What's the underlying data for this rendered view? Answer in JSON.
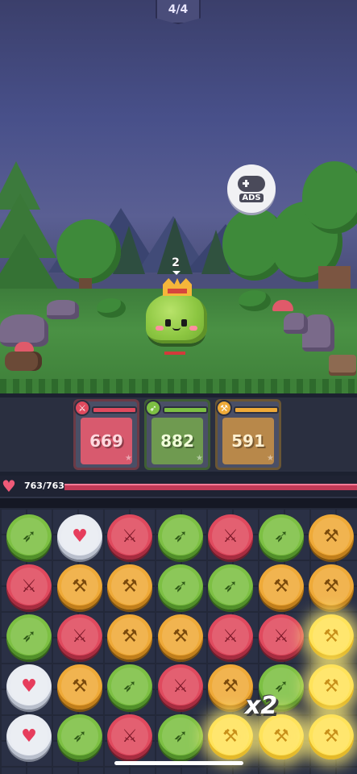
{
  "hud": {
    "wave": "4/4"
  },
  "ads_button": {
    "label": "ADS",
    "icon": "gamepad-icon"
  },
  "monster": {
    "level": "2",
    "name_icon": "crowned-slime-icon"
  },
  "attack_cards": [
    {
      "type": "sword",
      "value": "669",
      "color": "#e04a5e",
      "icon": "sword-icon"
    },
    {
      "type": "spear",
      "value": "882",
      "color": "#7dc043",
      "icon": "spear-icon"
    },
    {
      "type": "axe",
      "value": "591",
      "color": "#efaa38",
      "icon": "axe-icon"
    }
  ],
  "player": {
    "hp_text": "763/763",
    "hp_fraction": 1.0
  },
  "board": {
    "rows": [
      [
        "spear",
        "heart",
        "sword",
        "spear",
        "sword",
        "spear",
        "axe"
      ],
      [
        "sword",
        "axe",
        "axe",
        "spear",
        "spear",
        "axe",
        "axe"
      ],
      [
        "spear",
        "sword",
        "axe",
        "axe",
        "sword",
        "sword",
        "axe-glow"
      ],
      [
        "heart",
        "axe",
        "spear",
        "sword",
        "axe",
        "spear",
        "axe-glow"
      ],
      [
        "heart",
        "spear",
        "sword",
        "spear",
        "axe-glow",
        "axe-glow",
        "axe-glow"
      ]
    ]
  },
  "combo": {
    "label": "x2"
  }
}
